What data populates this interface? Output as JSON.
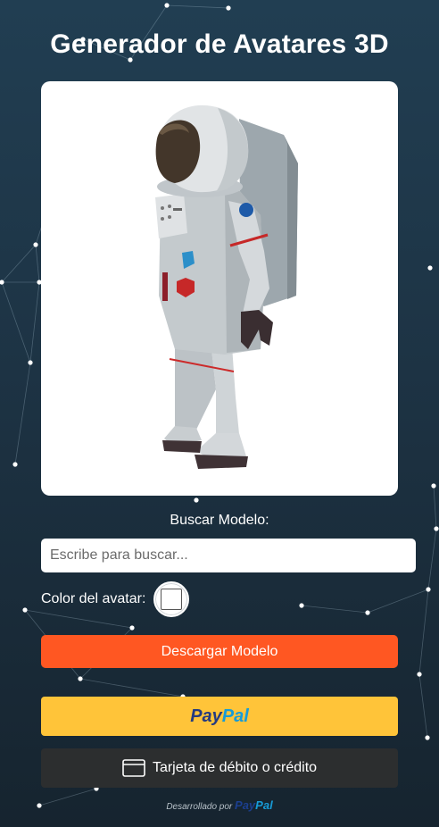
{
  "title": "Generador de Avatares 3D",
  "viewer": {
    "model_name": "astronaut",
    "background": "#ffffff"
  },
  "search": {
    "label": "Buscar Modelo:",
    "placeholder": "Escribe para buscar..."
  },
  "color": {
    "label": "Color del avatar:",
    "value": "#ffffff"
  },
  "download": {
    "label": "Descargar Modelo",
    "color": "#ff5722"
  },
  "payment": {
    "paypal": {
      "word_dark": "Pay",
      "word_light": "Pal",
      "color": "#ffc439"
    },
    "card": {
      "label": "Tarjeta de débito o crédito",
      "icon": "credit-card-icon"
    }
  },
  "footer": {
    "powered_by": "Desarrollado por",
    "brand_dark": "Pay",
    "brand_light": "Pal"
  },
  "colors": {
    "background_top": "#213e52",
    "background_bottom": "#16242f",
    "accent": "#ff5722",
    "paypal_yellow": "#ffc439",
    "card_dark": "#2c2e2f"
  }
}
